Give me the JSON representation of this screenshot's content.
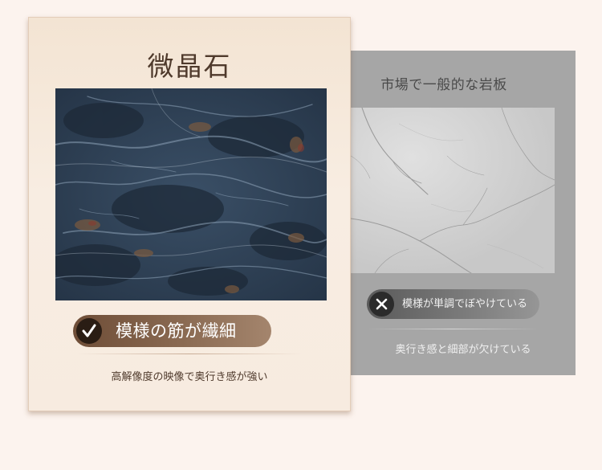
{
  "featured": {
    "title": "微晶石",
    "badge_label": "模様の筋が繊細",
    "badge_icon": "check-icon",
    "caption": "高解像度の映像で奥行き感が強い",
    "colors": {
      "card": "#f7ebe0",
      "badge": "#7a5a44",
      "title": "#4f3a2c"
    }
  },
  "compare": {
    "title": "市場で一般的な岩板",
    "badge_label": "模様が単調でぼやけている",
    "badge_icon": "close-icon",
    "caption": "奥行き感と細部が欠けている",
    "colors": {
      "card": "#a6a6a6",
      "badge": "#5a5a5a"
    }
  },
  "page": {
    "background": "#fcf3ee"
  }
}
